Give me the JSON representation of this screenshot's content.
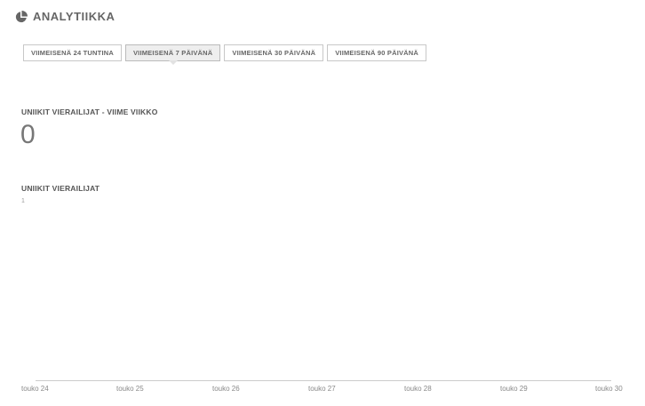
{
  "header": {
    "title": "ANALYTIIKKA",
    "icon": "pie-chart-icon"
  },
  "tabs": [
    {
      "label": "VIIMEISENÄ 24 TUNTINA",
      "active": false
    },
    {
      "label": "VIIMEISENÄ 7 PÄIVÄNÄ",
      "active": true
    },
    {
      "label": "VIIMEISENÄ 30 PÄIVÄNÄ",
      "active": false
    },
    {
      "label": "VIIMEISENÄ 90 PÄIVÄNÄ",
      "active": false
    }
  ],
  "summary": {
    "label": "UNIIKIT VIERAILIJAT - VIIME VIIKKO",
    "value": "0"
  },
  "chart_data": {
    "type": "line",
    "ylabel": "UNIIKIT VIERAILIJAT",
    "ymax_label": "1",
    "ylim": [
      0,
      1
    ],
    "categories": [
      "touko 24",
      "touko 25",
      "touko 26",
      "touko 27",
      "touko 28",
      "touko 29",
      "touko 30"
    ],
    "series": [
      {
        "values": [
          0,
          0,
          0,
          0,
          0,
          0,
          0
        ]
      }
    ]
  }
}
